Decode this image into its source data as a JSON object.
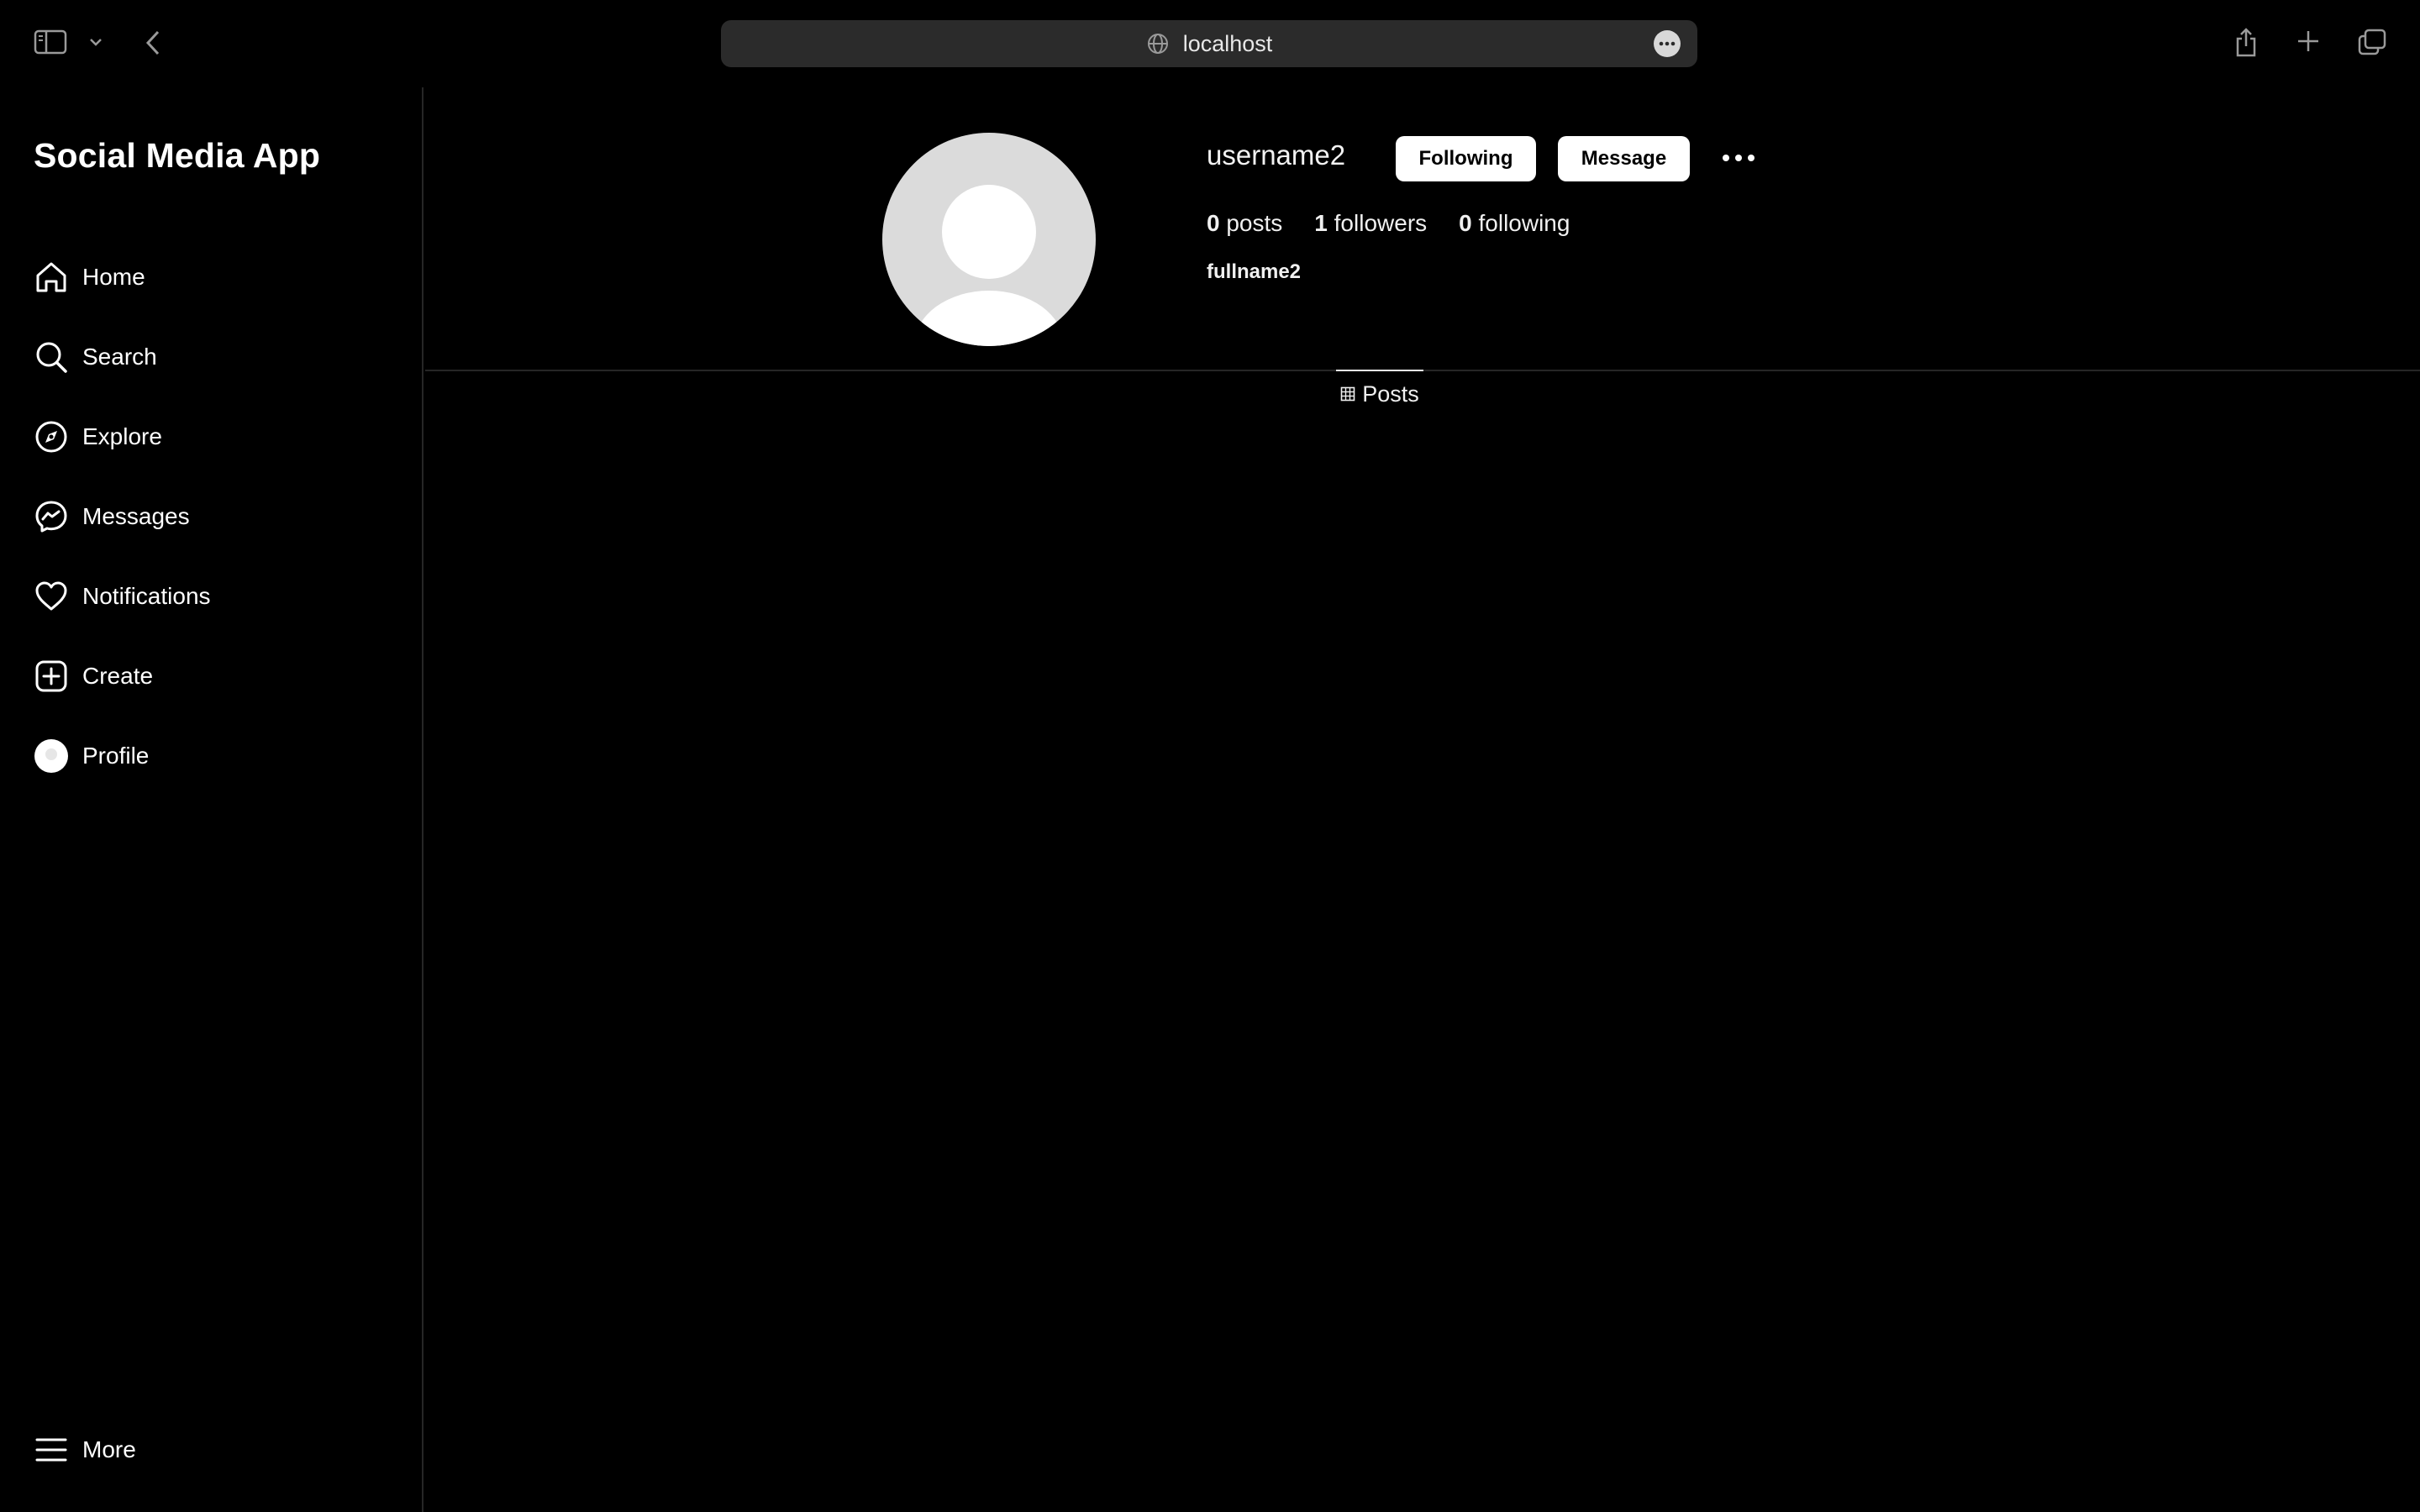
{
  "browser": {
    "url": "localhost",
    "icons": {
      "sidebar_toggle": "sidebar-icon",
      "dropdown": "chevron-down-icon",
      "back": "chevron-left-icon",
      "site": "globe-icon",
      "page_menu": "ellipsis-circle-icon",
      "share": "share-icon",
      "new_tab": "plus-icon",
      "tabs_overview": "tabs-icon"
    }
  },
  "sidebar": {
    "app_title": "Social Media App",
    "items": [
      {
        "label": "Home",
        "icon": "home-icon"
      },
      {
        "label": "Search",
        "icon": "search-icon"
      },
      {
        "label": "Explore",
        "icon": "compass-icon"
      },
      {
        "label": "Messages",
        "icon": "messenger-icon"
      },
      {
        "label": "Notifications",
        "icon": "heart-icon"
      },
      {
        "label": "Create",
        "icon": "plus-square-icon"
      },
      {
        "label": "Profile",
        "icon": "avatar-icon"
      }
    ],
    "more": {
      "label": "More",
      "icon": "menu-icon"
    }
  },
  "profile": {
    "username": "username2",
    "following_button": "Following",
    "message_button": "Message",
    "stats": {
      "posts_count": "0",
      "posts_label": "posts",
      "followers_count": "1",
      "followers_label": "followers",
      "following_count": "0",
      "following_label": "following"
    },
    "fullname": "fullname2"
  },
  "tabs": {
    "posts": "Posts"
  },
  "colors": {
    "background": "#000000",
    "text": "#ffffff",
    "url_bar": "#2b2b2b",
    "divider": "#262626",
    "avatar_bg": "#dbdbdb",
    "button_bg": "#ffffff"
  }
}
